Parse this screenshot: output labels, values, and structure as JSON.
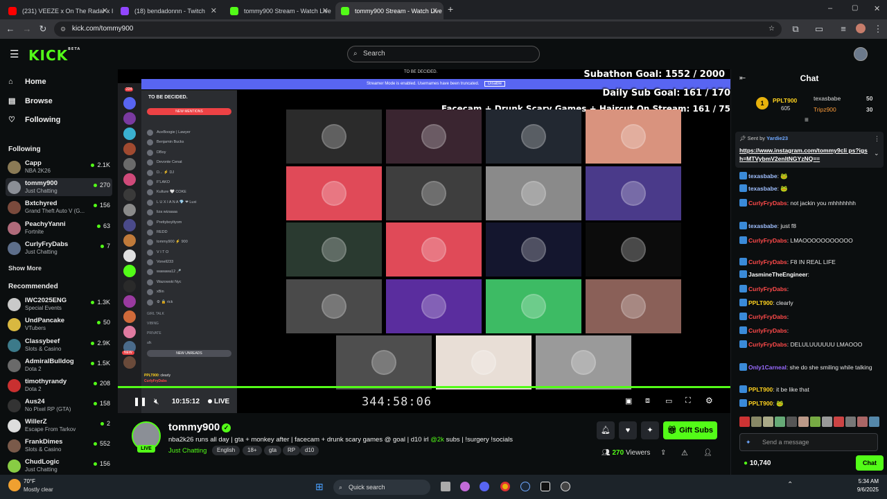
{
  "browser": {
    "tabs": [
      {
        "title": "(231) VEEZE x On The Radar x I",
        "color": "#ff0000"
      },
      {
        "title": "(18) bendadonnn - Twitch",
        "color": "#9146ff"
      },
      {
        "title": "tommy900 Stream - Watch Live",
        "color": "#53fc18"
      },
      {
        "title": "tommy900 Stream - Watch Live",
        "color": "#53fc18"
      }
    ],
    "url": "kick.com/tommy900",
    "window_controls": {
      "minimize": "–",
      "maximize": "▢",
      "close": "✕"
    },
    "new_tab": "+"
  },
  "kick": {
    "logo": "KICK",
    "logo_badge": "BETA",
    "search_placeholder": "Search",
    "accent": "#53fc18"
  },
  "sidebar": {
    "nav": [
      {
        "label": "Home",
        "icon": "home-icon"
      },
      {
        "label": "Browse",
        "icon": "browse-icon"
      },
      {
        "label": "Following",
        "icon": "heart-icon"
      }
    ],
    "following_heading": "Following",
    "following": [
      {
        "name": "Capp",
        "category": "NBA 2K26",
        "viewers": "2.1K",
        "color": "#8a7a55"
      },
      {
        "name": "tommy900",
        "category": "Just Chatting",
        "viewers": "270",
        "color": "#8b8f96"
      },
      {
        "name": "Bxtchyred",
        "category": "Grand Theft Auto V (G...",
        "viewers": "156",
        "color": "#7a4a3c"
      },
      {
        "name": "PeachyYanni",
        "category": "Fortnite",
        "viewers": "63",
        "color": "#b06a7a"
      },
      {
        "name": "CurlyFryDabs",
        "category": "Just Chatting",
        "viewers": "7",
        "color": "#5d6e8a"
      }
    ],
    "show_more": "Show More",
    "recommended_heading": "Recommended",
    "recommended": [
      {
        "name": "IWC2025ENG",
        "category": "Special Events",
        "viewers": "1.3K",
        "color": "#c9c9c9"
      },
      {
        "name": "UndPancake",
        "category": "VTubers",
        "viewers": "50",
        "color": "#d9b840"
      },
      {
        "name": "Classybeef",
        "category": "Slots & Casino",
        "viewers": "2.9K",
        "color": "#3c7a8a"
      },
      {
        "name": "AdmiralBulldog",
        "category": "Dota 2",
        "viewers": "1.5K",
        "color": "#6a6a6a"
      },
      {
        "name": "timothyrandy",
        "category": "Dota 2",
        "viewers": "208",
        "color": "#c93030"
      },
      {
        "name": "Aus24",
        "category": "No Pixel RP (GTA)",
        "viewers": "158",
        "color": "#333"
      },
      {
        "name": "WillerZ",
        "category": "Escape From Tarkov",
        "viewers": "2",
        "color": "#dddddd"
      },
      {
        "name": "FrankDimes",
        "category": "Slots & Casino",
        "viewers": "552",
        "color": "#7a5a4a"
      },
      {
        "name": "ChudLogic",
        "category": "Just Chatting",
        "viewers": "156",
        "color": "#88cc44"
      }
    ]
  },
  "video": {
    "server_label": "TO BE DECIDED.",
    "banner_text": "Streamer Mode is enabled. Usernames have been truncated.",
    "banner_button": "Disable",
    "overlay": {
      "subathon": "Subathon Goal: 1552 / 2000",
      "daily": "Daily Sub Goal:  161 / 170",
      "facecam": "Facecam + Drunk Scary Games + Haircut On Stream:  161 / 75"
    },
    "discord": {
      "title": "TO BE DECIDED.",
      "new_mentions": "NEW MENTIONS",
      "members": [
        "AceBoogie | Lawyer",
        "Benjamin Bucks",
        "DBoy",
        "Devonte Cenat",
        "D... ⚡ DJ",
        "F'LAKO",
        "Kulture 🤍 COKE",
        "L U X I A N A 💎 ❤ Luxi",
        "liza wizaaaa",
        "Prettyboyltyom",
        "REDD",
        "tommy900 ⚡ 900",
        "V I T O",
        "Vonell233",
        "wawawa12 🎤",
        "Wazowski Nyc",
        "xBin",
        "⚙ 🔒 rick"
      ],
      "channels": [
        "GIRL TALK",
        "VIBING",
        "PRIVATE",
        "afk"
      ],
      "new_unreads": "NEW UNREADS",
      "new_badge": "NEW",
      "rail_counts": [
        "224",
        "1",
        "2",
        "21",
        "5"
      ]
    },
    "tiles_row_colors": [
      [
        "#2b2b2b",
        "#3a2530",
        "#222831",
        "#d9937e"
      ],
      [
        "#e04a58",
        "#3e3e3e",
        "#8a8a8a",
        "#4a3a8a"
      ],
      [
        "#2a3a30",
        "#e04a58",
        "#14162e",
        "#0c0c0c"
      ],
      [
        "#4a4a4a",
        "#5a2d9e",
        "#3dbb64",
        "#8a6058"
      ],
      [
        "#4e4e4e",
        "#e8ded6",
        "#9a9a9a"
      ]
    ],
    "elapsed": "10:15:12",
    "live_label": "LIVE",
    "timer": "344:58:06",
    "progress_fraction": 0.99,
    "chat_overlay": [
      {
        "user": "PPLT900",
        "text": "clearly"
      },
      {
        "user": "CurlyFryDabs",
        "text": ""
      }
    ]
  },
  "stream": {
    "username": "tommy900",
    "live_badge": "LIVE",
    "title_before": "nba2k26 runs all day | gta + monkey after | facecam + drunk scary games @ goal | d10 irl ",
    "title_highlight": "@2k",
    "title_after": " subs | !surgery !socials",
    "category": "Just Chatting",
    "tags": [
      "English",
      "18+",
      "gta",
      "RP",
      "d10"
    ],
    "viewers_count": "270",
    "viewers_label": "Viewers",
    "gift_subs": "Gift Subs"
  },
  "chat": {
    "title": "Chat",
    "leaderboard": [
      {
        "name": "PPLT900",
        "score": "605",
        "rank": "1"
      },
      {
        "name": "texasbabe",
        "score": "50"
      },
      {
        "name": "Tripz900",
        "score": "30"
      }
    ],
    "pinned_sender_label": "Sent by",
    "pinned_sender": "Yardie23",
    "pinned_link": "https://www.instagram.com/tommy9cli ps?igsh=MTVybmV2enltNGYzNQ==",
    "messages": [
      {
        "user": "texasbabe",
        "text": "🐸",
        "color": "#a0c0ff"
      },
      {
        "user": "texasbabe",
        "text": "🐸",
        "color": "#a0c0ff"
      },
      {
        "user": "CurlyFryDabs",
        "text": "not jackin you mhhhhhhh",
        "color": "#ff4a4a"
      },
      {
        "user": "texasbabe",
        "text": "just f8",
        "color": "#a0c0ff"
      },
      {
        "user": "CurlyFryDabs",
        "text": "LMAOOOOOOOOOOO",
        "color": "#ff4a4a"
      },
      {
        "user": "CurlyFryDabs",
        "text": "F8 IN REAL LIFE",
        "color": "#ff4a4a"
      },
      {
        "user": "JasmineTheEngineer",
        "text": "",
        "color": "#ffffff"
      },
      {
        "user": "CurlyFryDabs",
        "text": "",
        "color": "#ff4a4a"
      },
      {
        "user": "PPLT900",
        "text": "clearly",
        "color": "#ffd21f"
      },
      {
        "user": "CurlyFryDabs",
        "text": "",
        "color": "#ff4a4a"
      },
      {
        "user": "CurlyFryDabs",
        "text": "",
        "color": "#ff4a4a"
      },
      {
        "user": "CurlyFryDabs",
        "text": "DELULUUUUUU LMAOOO",
        "color": "#ff4a4a"
      },
      {
        "user": "Only1Carneal",
        "text": "she do she smiling while talking",
        "color": "#9a6bff"
      },
      {
        "user": "PPLT900",
        "text": "it be like that",
        "color": "#ffd21f"
      },
      {
        "user": "PPLT900",
        "text": "🐸",
        "color": "#ffd21f"
      }
    ],
    "input_placeholder": "Send a message",
    "balance": "10,740",
    "send_label": "Chat"
  },
  "taskbar": {
    "weather_temp": "70°F",
    "weather_desc": "Mostly clear",
    "search": "Quick search",
    "time": "5:34 AM",
    "date": "9/6/2025"
  }
}
